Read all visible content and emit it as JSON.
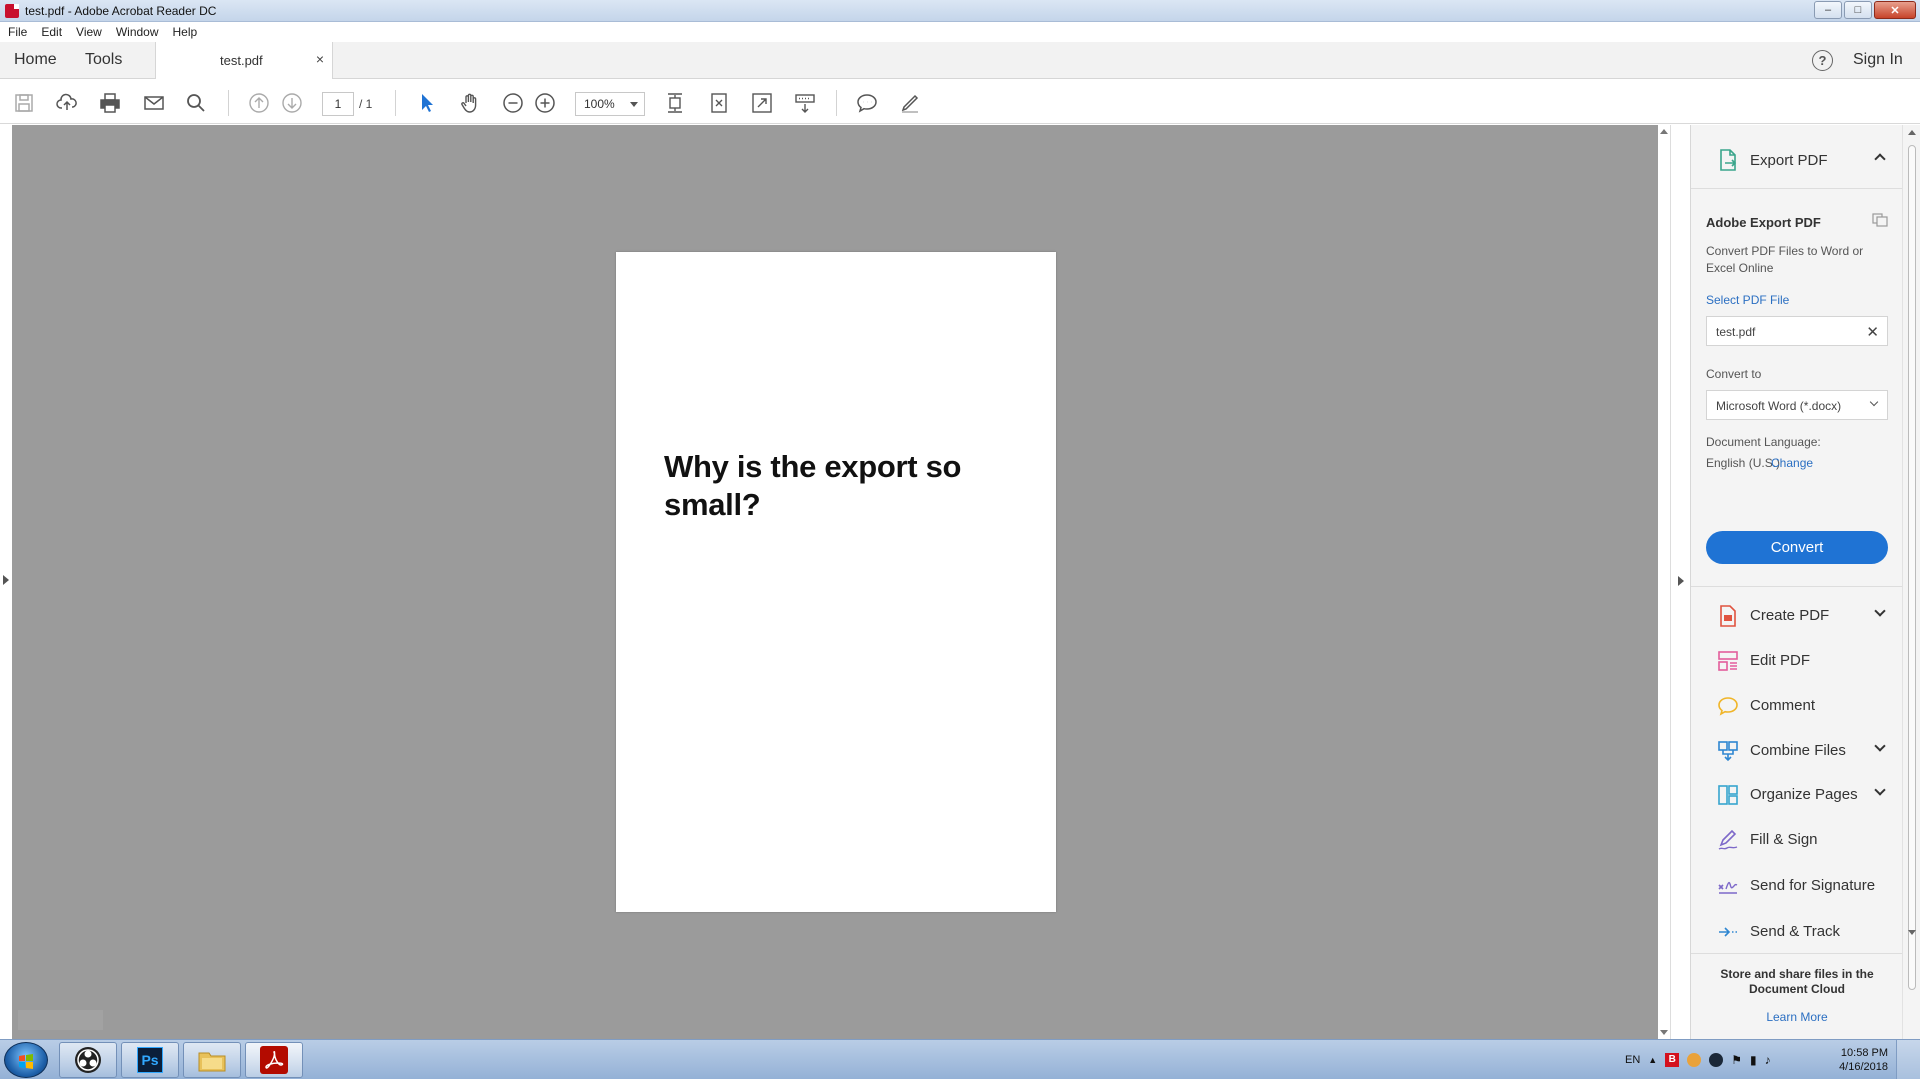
{
  "window": {
    "title": "test.pdf - Adobe Acrobat Reader DC",
    "minimize": "–",
    "maximize": "□",
    "close": "✕"
  },
  "menu": {
    "items": [
      {
        "label": "File"
      },
      {
        "label": "Edit"
      },
      {
        "label": "View"
      },
      {
        "label": "Window"
      },
      {
        "label": "Help"
      }
    ]
  },
  "tabs": {
    "home": "Home",
    "tools": "Tools",
    "document": "test.pdf",
    "close_glyph": "×",
    "help_glyph": "?",
    "sign_in": "Sign In"
  },
  "toolbar": {
    "icons": [
      "save-icon",
      "upload-cloud-icon",
      "print-icon",
      "email-icon",
      "search-icon",
      "page-up-icon",
      "page-down-icon",
      "select-cursor-icon",
      "hand-tool-icon",
      "zoom-out-icon",
      "zoom-in-icon",
      "scroll-mode-icon",
      "fit-page-icon",
      "fullscreen-icon",
      "read-mode-icon",
      "comment-icon",
      "draw-pen-icon"
    ],
    "page_current": "1",
    "page_total": "/ 1",
    "zoom": "100%"
  },
  "document": {
    "text": "Why is the export so small?"
  },
  "panel": {
    "export_pdf": "Export PDF",
    "adobe_export_title": "Adobe Export PDF",
    "description": "Convert PDF Files to Word or Excel Online",
    "select_file": "Select PDF File",
    "file_name": "test.pdf",
    "file_clear": "✕",
    "convert_to_label": "Convert to",
    "convert_to_value": "Microsoft Word (*.docx)",
    "language_label": "Document Language:",
    "language_value": "English (U.S.)",
    "language_change": "Change",
    "convert_button": "Convert",
    "tools": [
      {
        "label": "Create PDF",
        "icon": "create-pdf-icon",
        "color": "#e0533f",
        "expandable": true
      },
      {
        "label": "Edit PDF",
        "icon": "edit-pdf-icon",
        "color": "#e35d9b",
        "expandable": false
      },
      {
        "label": "Comment",
        "icon": "comment-bubble-icon",
        "color": "#f0b528",
        "expandable": false
      },
      {
        "label": "Combine Files",
        "icon": "combine-files-icon",
        "color": "#2e86d1",
        "expandable": true
      },
      {
        "label": "Organize Pages",
        "icon": "organize-pages-icon",
        "color": "#36a5cf",
        "expandable": true
      },
      {
        "label": "Fill & Sign",
        "icon": "fill-sign-icon",
        "color": "#7d68c9",
        "expandable": false
      },
      {
        "label": "Send for Signature",
        "icon": "send-signature-icon",
        "color": "#7d68c9",
        "expandable": false
      },
      {
        "label": "Send & Track",
        "icon": "send-track-icon",
        "color": "#2e86d1",
        "expandable": false
      }
    ],
    "cloud_text": "Store and share files in the Document Cloud",
    "learn_more": "Learn More"
  },
  "taskbar": {
    "apps": [
      "obs-icon",
      "photoshop-icon",
      "file-explorer-icon",
      "acrobat-icon"
    ],
    "photoshop_label": "Ps",
    "language": "EN",
    "time": "10:58 PM",
    "date": "4/16/2018"
  },
  "colors": {
    "accent_blue": "#1f73d4",
    "link_blue": "#2b6fc2",
    "canvas_gray": "#9b9b9b",
    "export_green": "#3aa58b"
  }
}
